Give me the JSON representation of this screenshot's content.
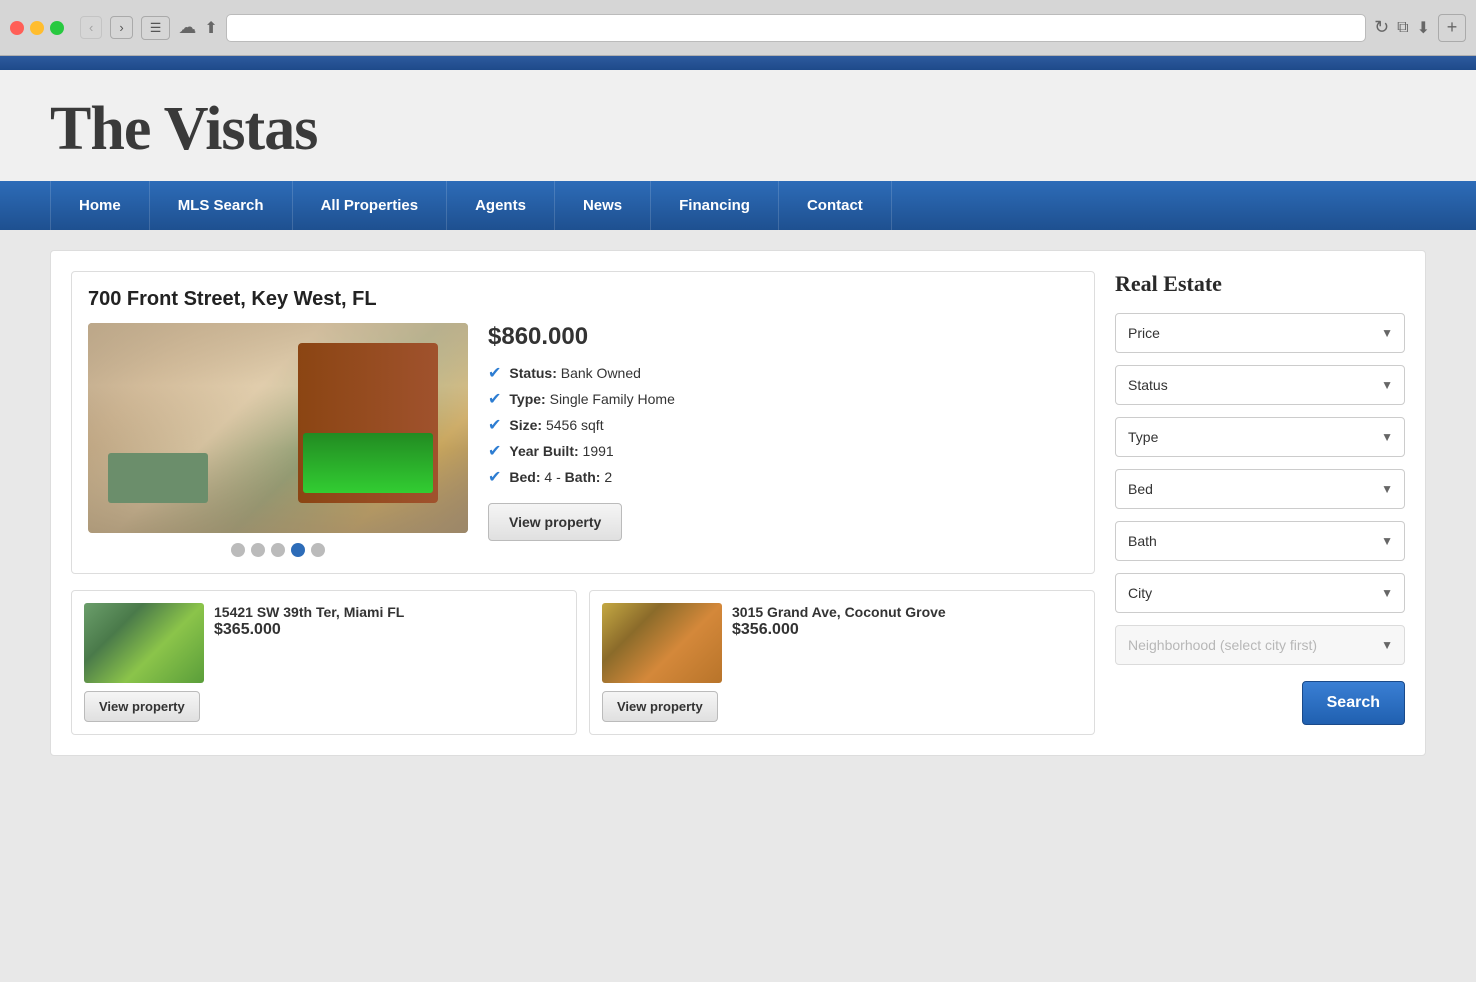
{
  "browser": {
    "address_placeholder": ""
  },
  "site": {
    "title": "The Vistas",
    "top_bar_color": "#2d5a9e"
  },
  "nav": {
    "items": [
      {
        "id": "home",
        "label": "Home"
      },
      {
        "id": "mls-search",
        "label": "MLS Search"
      },
      {
        "id": "all-properties",
        "label": "All Properties"
      },
      {
        "id": "agents",
        "label": "Agents"
      },
      {
        "id": "news",
        "label": "News"
      },
      {
        "id": "financing",
        "label": "Financing"
      },
      {
        "id": "contact",
        "label": "Contact"
      }
    ]
  },
  "featured_property": {
    "address": "700 Front Street, Key West, FL",
    "price": "$860.000",
    "status": "Bank Owned",
    "type": "Single Family Home",
    "size": "5456 sqft",
    "year_built": "1991",
    "bed": "4",
    "bath": "2",
    "view_button": "View property",
    "carousel_dots": 5,
    "active_dot": 3
  },
  "property_cards": [
    {
      "address": "15421 SW 39th Ter, Miami FL",
      "price": "$365.000",
      "view_button": "View property"
    },
    {
      "address": "3015 Grand Ave, Coconut Grove",
      "price": "$356.000",
      "view_button": "View property"
    }
  ],
  "sidebar": {
    "title": "Real Estate",
    "filters": [
      {
        "id": "price",
        "label": "Price",
        "options": [
          "Price"
        ]
      },
      {
        "id": "status",
        "label": "Status",
        "options": [
          "Status"
        ]
      },
      {
        "id": "type",
        "label": "Type",
        "options": [
          "Type"
        ]
      },
      {
        "id": "bed",
        "label": "Bed",
        "options": [
          "Bed"
        ]
      },
      {
        "id": "bath",
        "label": "Bath",
        "options": [
          "Bath"
        ]
      },
      {
        "id": "city",
        "label": "City",
        "options": [
          "City"
        ]
      }
    ],
    "neighborhood_placeholder": "Neighborhood (select city first)",
    "search_button": "Search"
  }
}
